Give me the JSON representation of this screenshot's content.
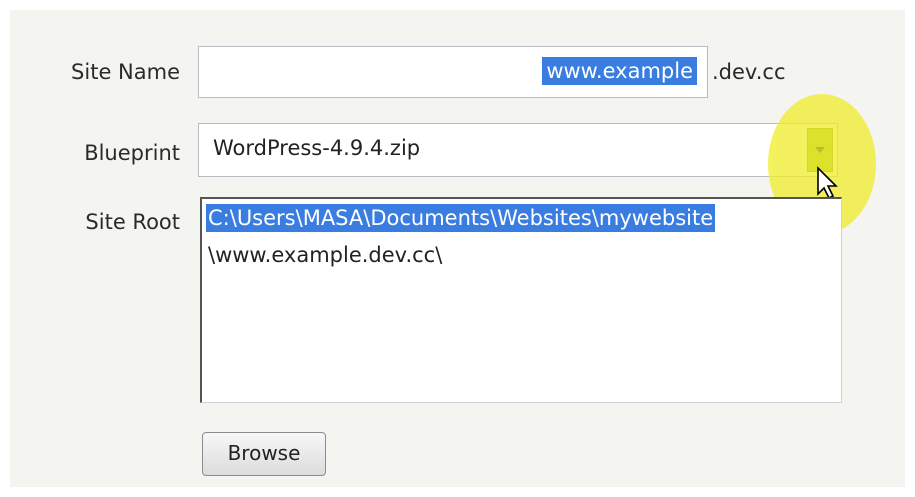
{
  "form": {
    "site_name": {
      "label": "Site Name",
      "value": "www.example",
      "suffix": ".dev.cc"
    },
    "blueprint": {
      "label": "Blueprint",
      "selected": "WordPress-4.9.4.zip"
    },
    "site_root": {
      "label": "Site Root",
      "line1": "C:\\Users\\MASA\\Documents\\Websites\\mywebsite",
      "line2": "\\www.example.dev.cc\\"
    },
    "browse_label": "Browse"
  },
  "colors": {
    "selection": "#3a7de0",
    "dropdown_button": "#9ec23a",
    "cursor_highlight": "#f0ec28"
  },
  "icons": {
    "dropdown": "chevron-down-icon",
    "cursor": "mouse-pointer-icon"
  }
}
